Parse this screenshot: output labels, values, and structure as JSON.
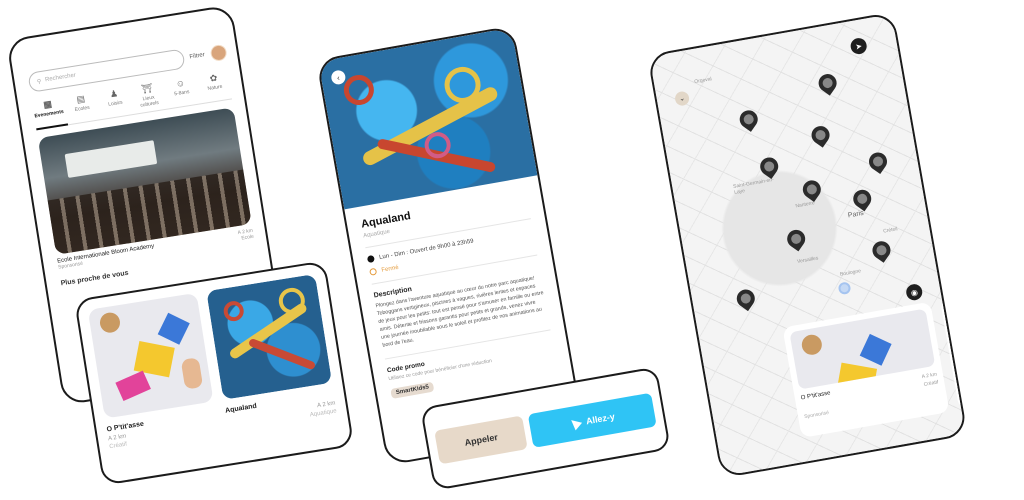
{
  "list_screen": {
    "search_placeholder": "Rechercher",
    "filter_label": "Filtrer",
    "categories": [
      {
        "label": "Evenements",
        "icon": "calendar-icon"
      },
      {
        "label": "Ecoles",
        "icon": "book-icon"
      },
      {
        "label": "Loisirs",
        "icon": "person-icon"
      },
      {
        "label": "Lieux culturels",
        "icon": "museum-icon"
      },
      {
        "label": "5-8ans",
        "icon": "child-icon"
      },
      {
        "label": "Nature",
        "icon": "leaf-icon"
      }
    ],
    "featured": {
      "name": "Ecole Internationale Bloom Academy",
      "distance": "A 2 km",
      "category": "Ecole",
      "sponsor": "Sponsorisé"
    },
    "section_title": "Plus proche de vous"
  },
  "nearby_cards": [
    {
      "name": "O P'tit'asse",
      "distance": "A 2 km",
      "category": "Créatif"
    },
    {
      "name": "Aqualand",
      "distance": "A 2 km",
      "category": "Aquatique"
    }
  ],
  "detail_screen": {
    "title": "Aqualand",
    "category": "Aquatique",
    "hours": "Lun - Dim : Ouvert de 9h00 à 23h59",
    "status": "Fermé",
    "description_title": "Description",
    "description": "Plongez dans l'aventure aquatique au cœur du notre parc aquatique! Toboggans vertigineux, piscines à vagues, rivières lentes et espaces de jeux pour les petits: tout est pensé pour s'amuser en famille ou entre amis. Détente et frissons garantis pour petits et grands, venez vivre une journée inoubliable sous le soleil et profitez de nos animations au bord de l'eau.",
    "promo_title": "Code promo",
    "promo_subtitle": "Utilisez ce code pour bénéficier d'une réduction",
    "promo_code": "SmartKids5"
  },
  "actions": {
    "call_label": "Appeler",
    "go_label": "Allez-y"
  },
  "map_screen": {
    "labels": [
      "Orgeval",
      "Saint-Germain-en-Laye",
      "Nanterre",
      "Paris",
      "Versailles",
      "Créteil",
      "Boulogne"
    ],
    "cards": [
      {
        "name": "O P'tit'asse",
        "distance": "A 2 km",
        "category": "Créatif",
        "sponsor": "Sponsorisé"
      },
      {
        "name": "Aqualand",
        "sponsor": "Sponsorisé"
      }
    ]
  }
}
